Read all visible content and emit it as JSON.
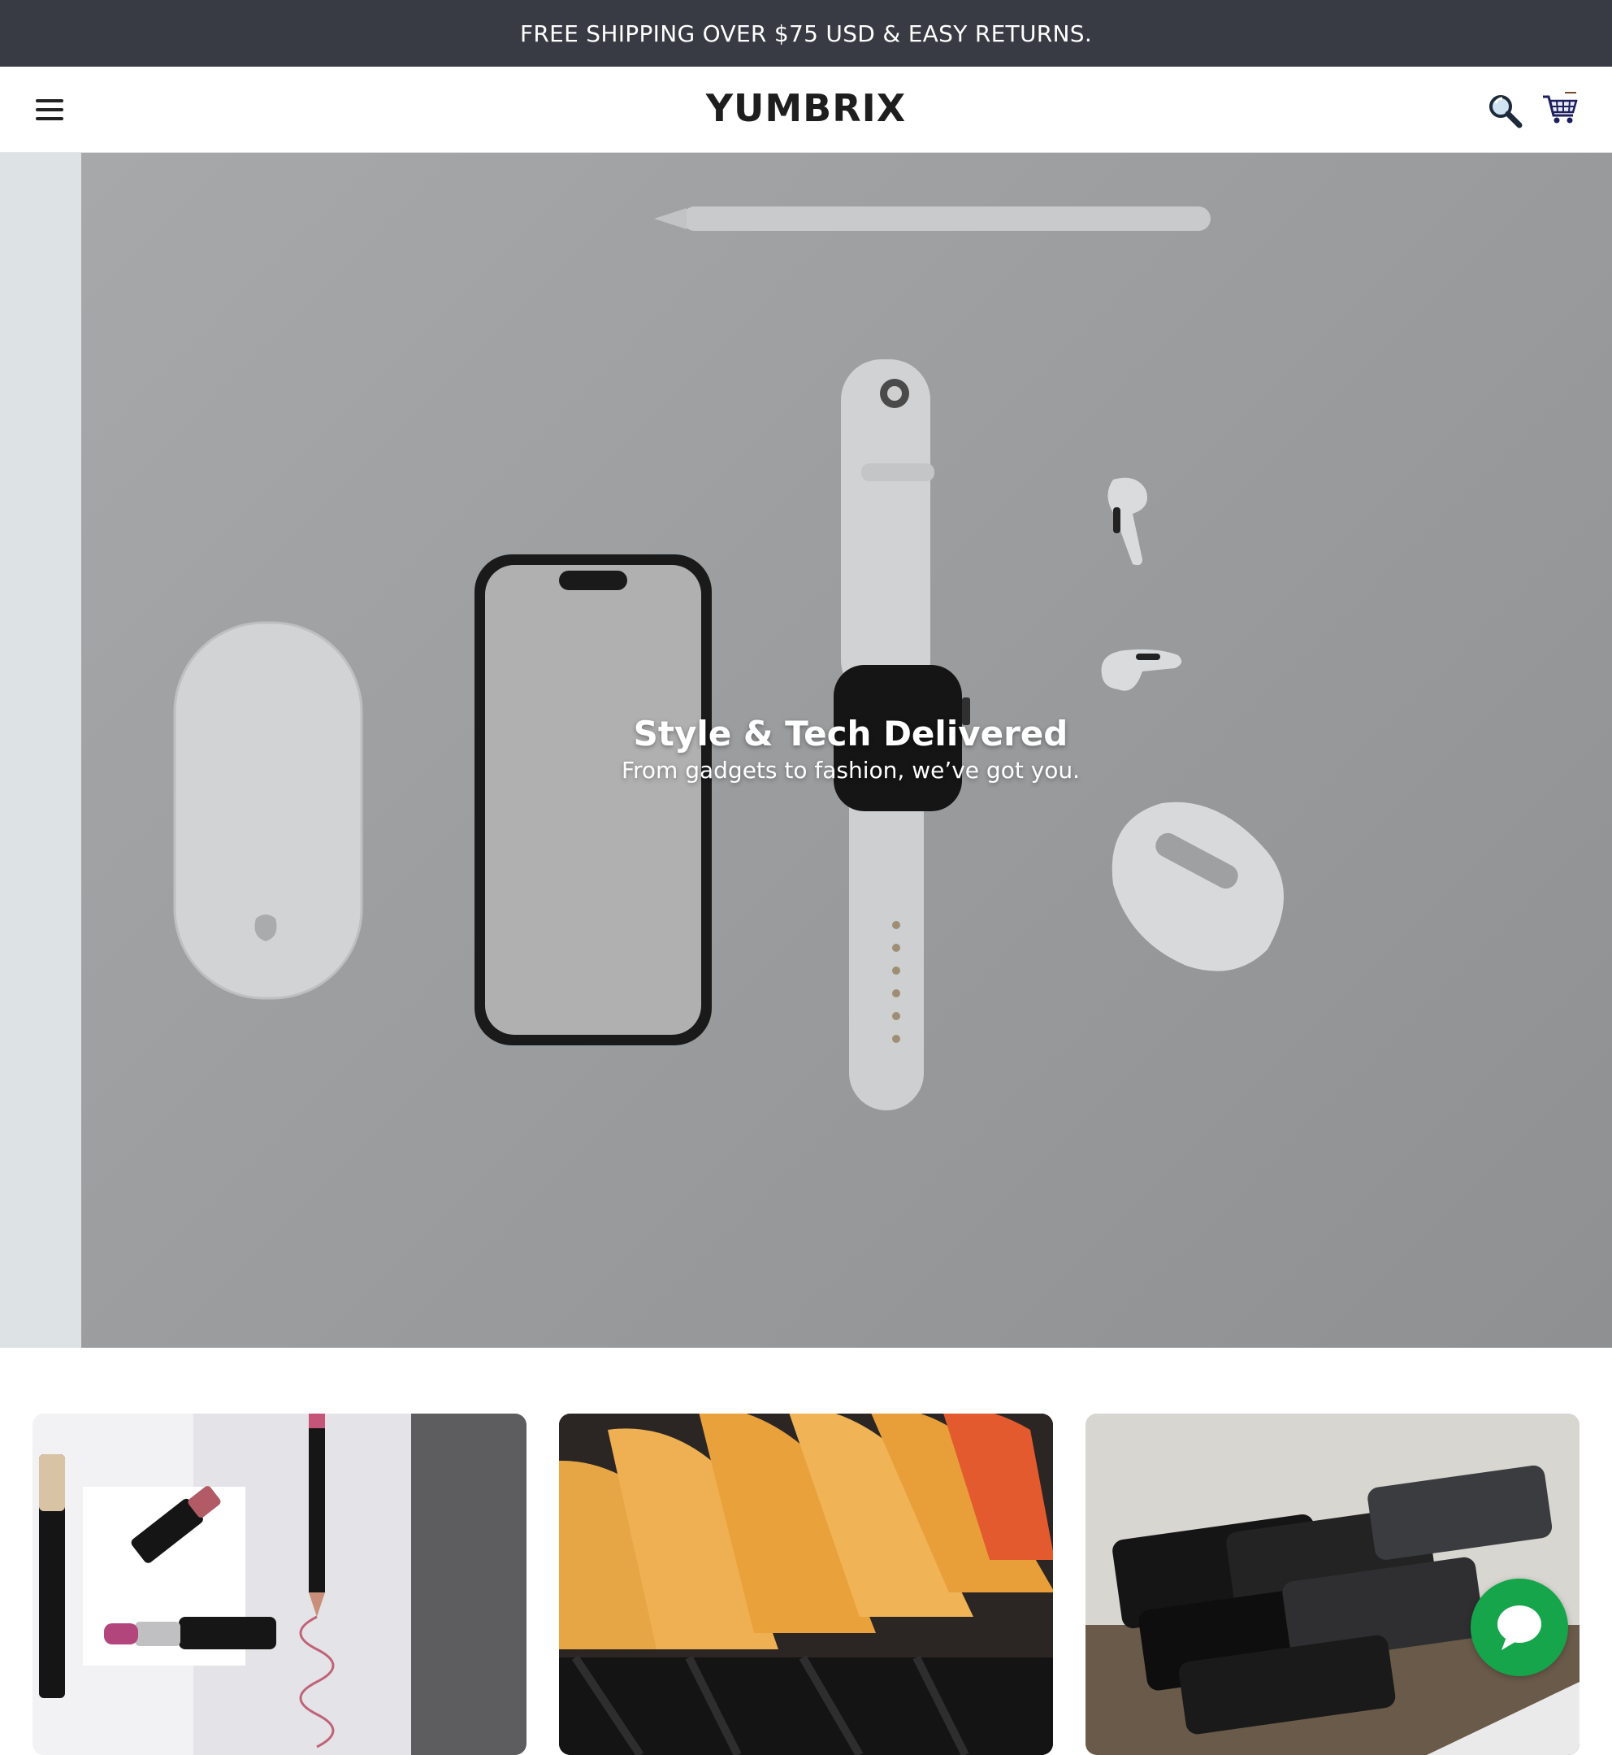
{
  "announcement": {
    "text": "FREE SHIPPING OVER $75 USD & EASY RETURNS."
  },
  "header": {
    "logo": "YUMBRIX",
    "menu_icon": "hamburger-menu-icon",
    "search_icon": "search-icon",
    "cart_icon": "cart-icon"
  },
  "hero": {
    "title": "Style & Tech Delivered",
    "subtitle": "From gadgets to fashion, we’ve got you."
  },
  "category_cards": [
    {
      "image": "cosmetics-lipsticks"
    },
    {
      "image": "clothes-on-hangers"
    },
    {
      "image": "smartphones-stack"
    }
  ],
  "chat": {
    "icon": "chat-bubble-icon"
  },
  "colors": {
    "announcement_bg": "#383b43",
    "chat_button": "#16a54b"
  }
}
